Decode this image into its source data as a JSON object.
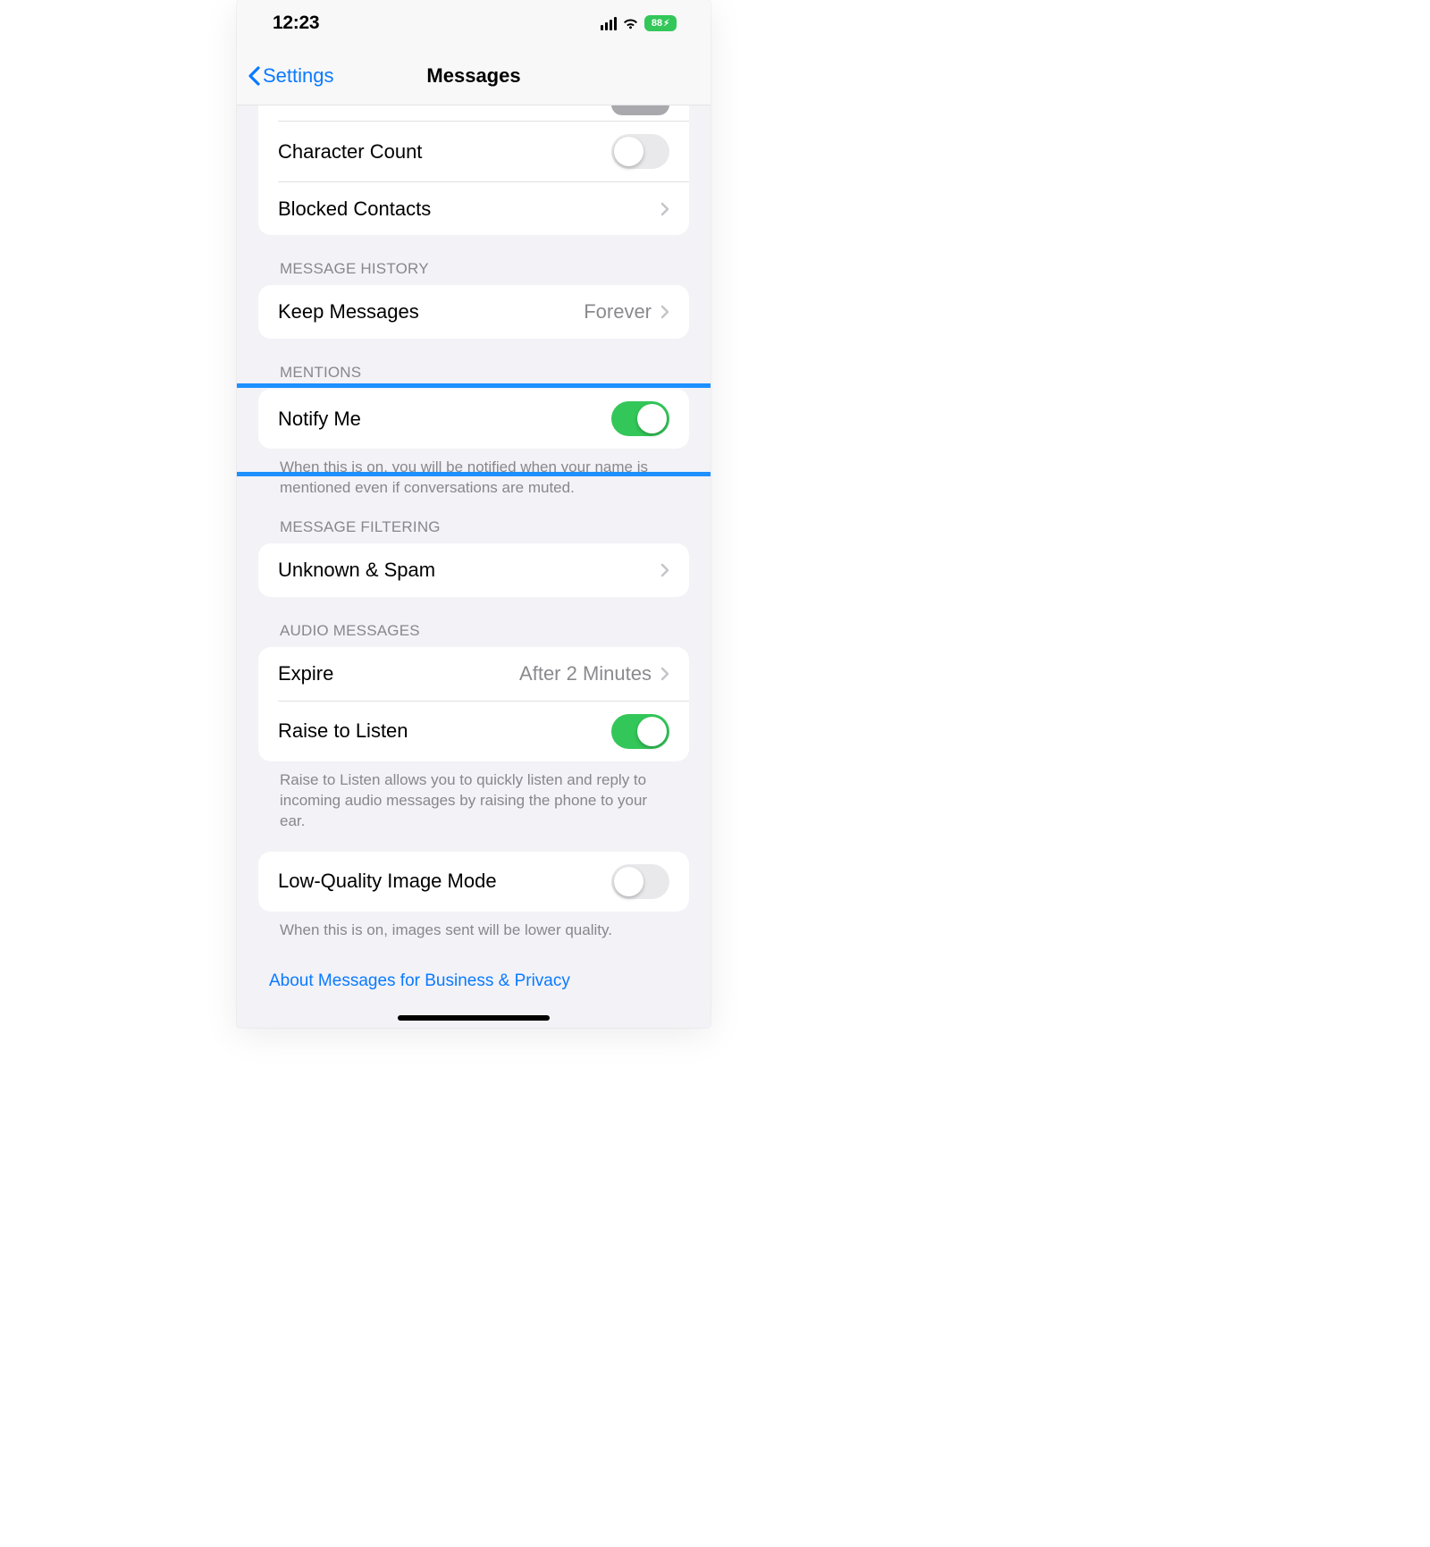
{
  "statusbar": {
    "time": "12:23",
    "battery": "88"
  },
  "nav": {
    "back": "Settings",
    "title": "Messages"
  },
  "rows": {
    "characterCount": {
      "label": "Character Count",
      "on": false
    },
    "blockedContacts": {
      "label": "Blocked Contacts"
    }
  },
  "messageHistory": {
    "header": "MESSAGE HISTORY",
    "keepMessages": {
      "label": "Keep Messages",
      "value": "Forever"
    }
  },
  "mentions": {
    "header": "MENTIONS",
    "notifyMe": {
      "label": "Notify Me",
      "on": true
    },
    "footer": "When this is on, you will be notified when your name is mentioned even if conversations are muted."
  },
  "messageFiltering": {
    "header": "MESSAGE FILTERING",
    "unknownSpam": {
      "label": "Unknown & Spam"
    }
  },
  "audioMessages": {
    "header": "AUDIO MESSAGES",
    "expire": {
      "label": "Expire",
      "value": "After 2 Minutes"
    },
    "raiseToListen": {
      "label": "Raise to Listen",
      "on": true
    },
    "footer": "Raise to Listen allows you to quickly listen and reply to incoming audio messages by raising the phone to your ear."
  },
  "lowQuality": {
    "label": "Low-Quality Image Mode",
    "on": false,
    "footer": "When this is on, images sent will be lower quality."
  },
  "aboutLink": "About Messages for Business & Privacy"
}
